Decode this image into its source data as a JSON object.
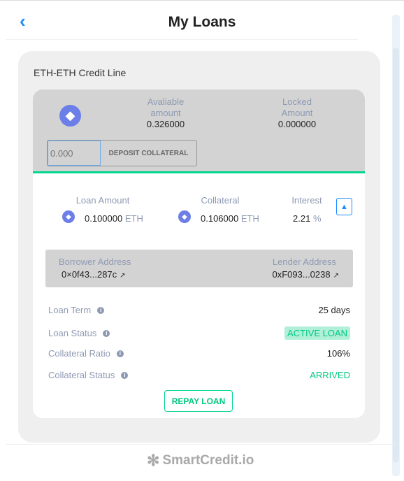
{
  "header": {
    "title": "My Loans",
    "back_icon": "chevron-left-icon"
  },
  "card": {
    "title": "ETH-ETH Credit Line",
    "available_label": "Avaliable amount",
    "available_value": "0.326000",
    "locked_label": "Locked Amount",
    "locked_value": "0.000000",
    "deposit_placeholder": "0.000",
    "deposit_button": "DEPOSIT COLLATERAL",
    "loan_amount_label": "Loan Amount",
    "loan_amount_value": "0.100000",
    "loan_amount_unit": "ETH",
    "collateral_label": "Collateral",
    "collateral_value": "0.106000",
    "collateral_unit": "ETH",
    "interest_label": "Interest",
    "interest_value": "2.21",
    "interest_unit": "%",
    "borrower_label": "Borrower Address",
    "borrower_value": "0×0f43...287c",
    "lender_label": "Lender Address",
    "lender_value": "0xF093...0238",
    "details": [
      {
        "label": "Loan Term",
        "value": "25 days"
      },
      {
        "label": "Loan Status",
        "value": "ACTIVE LOAN"
      },
      {
        "label": "Collateral Ratio",
        "value": "106%"
      },
      {
        "label": "Collateral Status",
        "value": "ARRIVED"
      }
    ],
    "repay_button": "REPAY LOAN"
  },
  "footer": {
    "logo": "SmartCredit.io"
  },
  "colors": {
    "accent": "#1a8cff",
    "green": "#00d68f",
    "muted": "#8e9ab3"
  }
}
